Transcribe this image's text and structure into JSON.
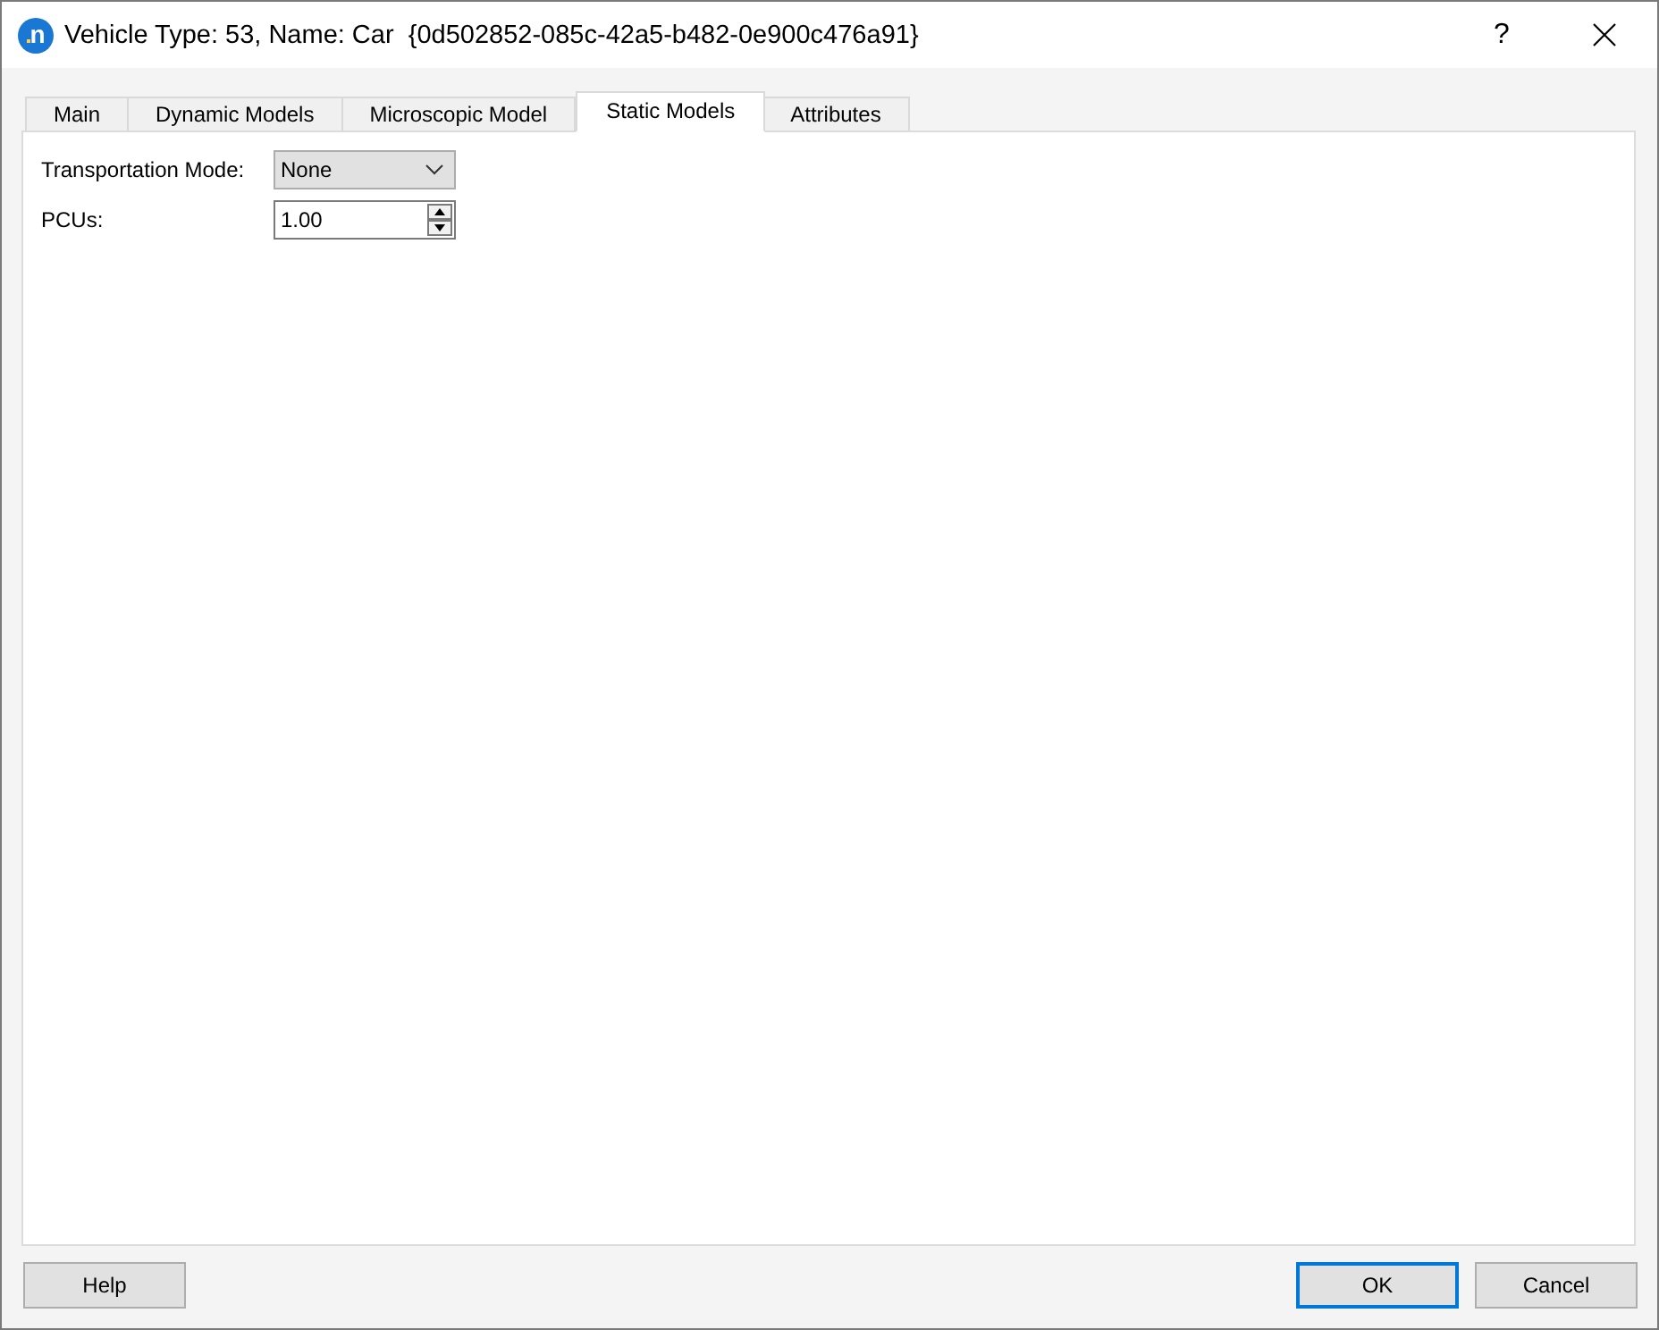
{
  "window": {
    "logo": "n",
    "title": "Vehicle Type: 53, Name: Car  {0d502852-085c-42a5-b482-0e900c476a91}",
    "help_button": "?"
  },
  "tabs": [
    {
      "label": "Main",
      "selected": false
    },
    {
      "label": "Dynamic Models",
      "selected": false
    },
    {
      "label": "Microscopic Model",
      "selected": false
    },
    {
      "label": "Static Models",
      "selected": true
    },
    {
      "label": "Attributes",
      "selected": false
    }
  ],
  "form": {
    "fields": [
      {
        "kind": "dropdown",
        "label": "Transportation Mode:",
        "value": "None"
      },
      {
        "kind": "spinbox",
        "label": "PCUs:",
        "value": "1.00"
      }
    ]
  },
  "left_buttons": [
    {
      "label": "Help",
      "default": false
    }
  ],
  "right_buttons": [
    {
      "label": "OK",
      "default": true
    },
    {
      "label": "Cancel",
      "default": false
    }
  ]
}
